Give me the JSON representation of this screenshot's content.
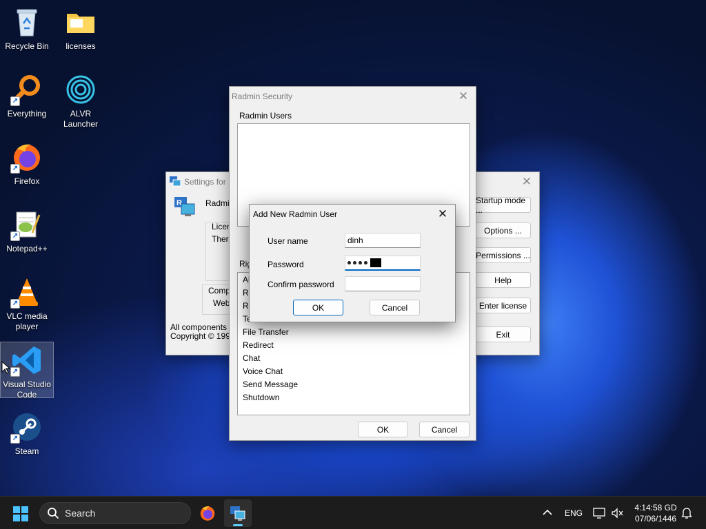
{
  "desktop": {
    "icons": [
      {
        "label": "Recycle Bin"
      },
      {
        "label": "licenses"
      },
      {
        "label": "Everything"
      },
      {
        "label": "ALVR Launcher"
      },
      {
        "label": "Firefox"
      },
      {
        "label": "Notepad++"
      },
      {
        "label": "VLC media player"
      },
      {
        "label": "Visual Studio Code"
      },
      {
        "label": "Steam"
      }
    ]
  },
  "settings_window": {
    "title": "Settings for",
    "app_name": "Radmin",
    "license_label": "Licen",
    "license_text": "There",
    "company_label": "Compa",
    "web_label": "Web",
    "footer_line1": "All components fro",
    "footer_line2": "Copyright © 1999-",
    "hidden_button_tail": "er",
    "buttons": {
      "startup_mode": "Startup mode ...",
      "options": "Options ...",
      "permissions": "Permissions ...",
      "help": "Help",
      "enter_license": "Enter license",
      "exit": "Exit"
    }
  },
  "security_window": {
    "title": "Radmin Security",
    "users_label": "Radmin Users",
    "rights_label": "Rig",
    "rights": [
      "Al",
      "Re",
      "Re",
      "Te",
      "File Transfer",
      "Redirect",
      "Chat",
      "Voice Chat",
      "Send Message",
      "Shutdown"
    ],
    "ok": "OK",
    "cancel": "Cancel"
  },
  "add_user_dialog": {
    "title": "Add New Radmin User",
    "username_label": "User name",
    "username_value": "dinh",
    "password_label": "Password",
    "confirm_label": "Confirm password",
    "ok": "OK",
    "cancel": "Cancel"
  },
  "taskbar": {
    "search_label": "Search",
    "language": "ENG",
    "time": "4:14:58 GD",
    "date": "07/06/1446"
  },
  "colors": {
    "accent": "#0067c0",
    "taskbar": "#1c1c1c",
    "dialog": "#f0f0f0"
  }
}
